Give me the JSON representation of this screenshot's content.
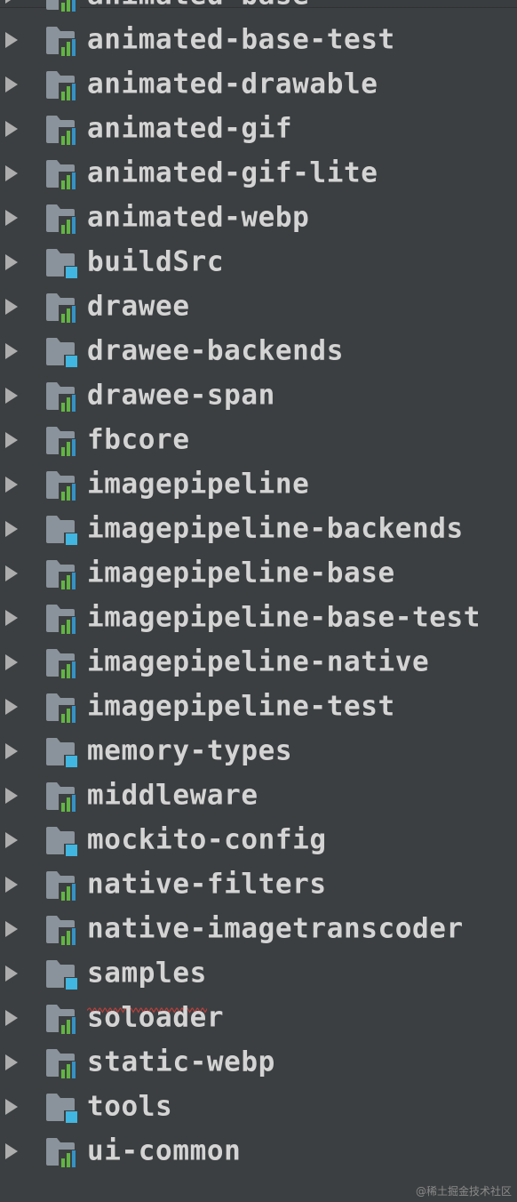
{
  "tree": {
    "items": [
      {
        "label": "animated-base",
        "icon": "gradle-module-folder-icon",
        "squiggle": false
      },
      {
        "label": "animated-base-test",
        "icon": "gradle-module-folder-icon",
        "squiggle": false
      },
      {
        "label": "animated-drawable",
        "icon": "gradle-module-folder-icon",
        "squiggle": false
      },
      {
        "label": "animated-gif",
        "icon": "gradle-module-folder-icon",
        "squiggle": false
      },
      {
        "label": "animated-gif-lite",
        "icon": "gradle-module-folder-icon",
        "squiggle": false
      },
      {
        "label": "animated-webp",
        "icon": "gradle-module-folder-icon",
        "squiggle": false
      },
      {
        "label": "buildSrc",
        "icon": "module-folder-icon",
        "squiggle": false
      },
      {
        "label": "drawee",
        "icon": "gradle-module-folder-icon",
        "squiggle": false
      },
      {
        "label": "drawee-backends",
        "icon": "module-folder-icon",
        "squiggle": false
      },
      {
        "label": "drawee-span",
        "icon": "gradle-module-folder-icon",
        "squiggle": false
      },
      {
        "label": "fbcore",
        "icon": "gradle-module-folder-icon",
        "squiggle": false
      },
      {
        "label": "imagepipeline",
        "icon": "gradle-module-folder-icon",
        "squiggle": false
      },
      {
        "label": "imagepipeline-backends",
        "icon": "module-folder-icon",
        "squiggle": false
      },
      {
        "label": "imagepipeline-base",
        "icon": "gradle-module-folder-icon",
        "squiggle": false
      },
      {
        "label": "imagepipeline-base-test",
        "icon": "gradle-module-folder-icon",
        "squiggle": false
      },
      {
        "label": "imagepipeline-native",
        "icon": "gradle-module-folder-icon",
        "squiggle": false
      },
      {
        "label": "imagepipeline-test",
        "icon": "gradle-module-folder-icon",
        "squiggle": false
      },
      {
        "label": "memory-types",
        "icon": "module-folder-icon",
        "squiggle": false
      },
      {
        "label": "middleware",
        "icon": "gradle-module-folder-icon",
        "squiggle": false
      },
      {
        "label": "mockito-config",
        "icon": "module-folder-icon",
        "squiggle": false
      },
      {
        "label": "native-filters",
        "icon": "gradle-module-folder-icon",
        "squiggle": false
      },
      {
        "label": "native-imagetranscoder",
        "icon": "gradle-module-folder-icon",
        "squiggle": false
      },
      {
        "label": "samples",
        "icon": "module-folder-icon",
        "squiggle": true
      },
      {
        "label": "soloader",
        "icon": "gradle-module-folder-icon",
        "squiggle": false
      },
      {
        "label": "static-webp",
        "icon": "gradle-module-folder-icon",
        "squiggle": false
      },
      {
        "label": "tools",
        "icon": "module-folder-icon",
        "squiggle": false
      },
      {
        "label": "ui-common",
        "icon": "gradle-module-folder-icon",
        "squiggle": false
      }
    ]
  },
  "watermark": "@稀土掘金技术社区",
  "colors": {
    "background": "#3c3f41",
    "text": "#d4d4d4",
    "folder": "#8a939b",
    "bar_green": "#62b543",
    "bar_blue": "#3592c4",
    "module_square": "#40b6e0",
    "squiggle": "#bc3f3c"
  }
}
